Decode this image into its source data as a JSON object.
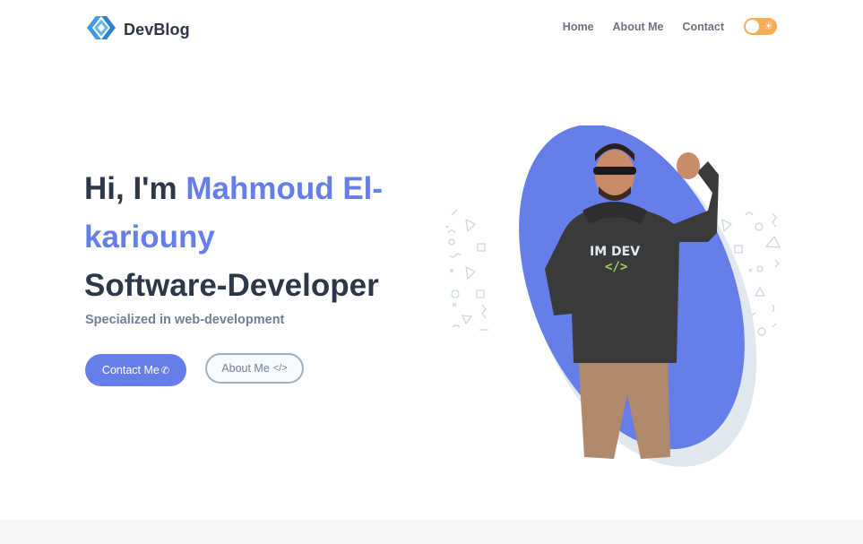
{
  "brand": {
    "name": "DevBlog",
    "logo_icon": "diamond-logo-icon",
    "accent": "#667eea",
    "dark": "#2d3748"
  },
  "nav": {
    "links": [
      {
        "label": "Home"
      },
      {
        "label": "About Me"
      },
      {
        "label": "Contact"
      }
    ],
    "theme_toggle": {
      "state": "light",
      "icon": "sun-icon",
      "color": "#f6ad55"
    }
  },
  "hero": {
    "greeting": "Hi, I'm ",
    "name": "Mahmoud El-kariouny",
    "role": "Software-Developer",
    "tagline": "Specialized in web-development",
    "primary_button": {
      "label": "Contact Me",
      "icon": "phone-icon"
    },
    "secondary_button": {
      "label": "About Me",
      "icon": "code-icon"
    },
    "photo": {
      "hoodie_text": "IM DEV",
      "hoodie_icon": "code-brackets-icon",
      "blob_color": "#667eea"
    }
  }
}
